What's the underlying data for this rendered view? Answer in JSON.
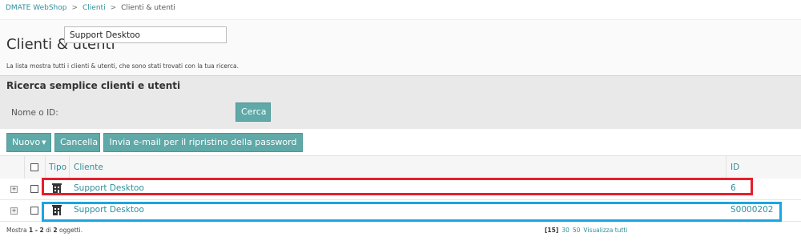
{
  "breadcrumb": {
    "items": [
      "DMATE WebShop",
      "Clienti",
      "Clienti & utenti"
    ],
    "separator": ">"
  },
  "page": {
    "title": "Clienti & utenti",
    "description": "La lista mostra tutti i clienti & utenti, che sono stati trovati con la tua ricerca."
  },
  "search": {
    "title": "Ricerca semplice clienti e utenti",
    "field_label": "Nome o ID:",
    "field_value": "Support Desktoo",
    "button_label": "Cerca"
  },
  "toolbar": {
    "new_label": "Nuovo",
    "cancel_label": "Cancella",
    "reset_label": "Invia e-mail per il ripristino della password"
  },
  "table": {
    "headers": {
      "type": "Tipo",
      "customer": "Cliente",
      "id": "ID"
    },
    "rows": [
      {
        "name": "Support Desktoo",
        "id": "6",
        "type_icon": "building-icon"
      },
      {
        "name": "Support Desktoo",
        "id": "S0000202",
        "type_icon": "building-icon"
      }
    ]
  },
  "footer": {
    "prefix": "Mostra",
    "range": "1 - 2",
    "of": "di",
    "total": "2",
    "suffix": "oggetti.",
    "page_sizes": [
      "[15]",
      "30",
      "50",
      "Visualizza tutti"
    ]
  },
  "colors": {
    "accent": "#2f8f9d",
    "button": "#5fa9a8",
    "highlight_red": "#e4202b",
    "highlight_blue": "#1aa6e2"
  }
}
